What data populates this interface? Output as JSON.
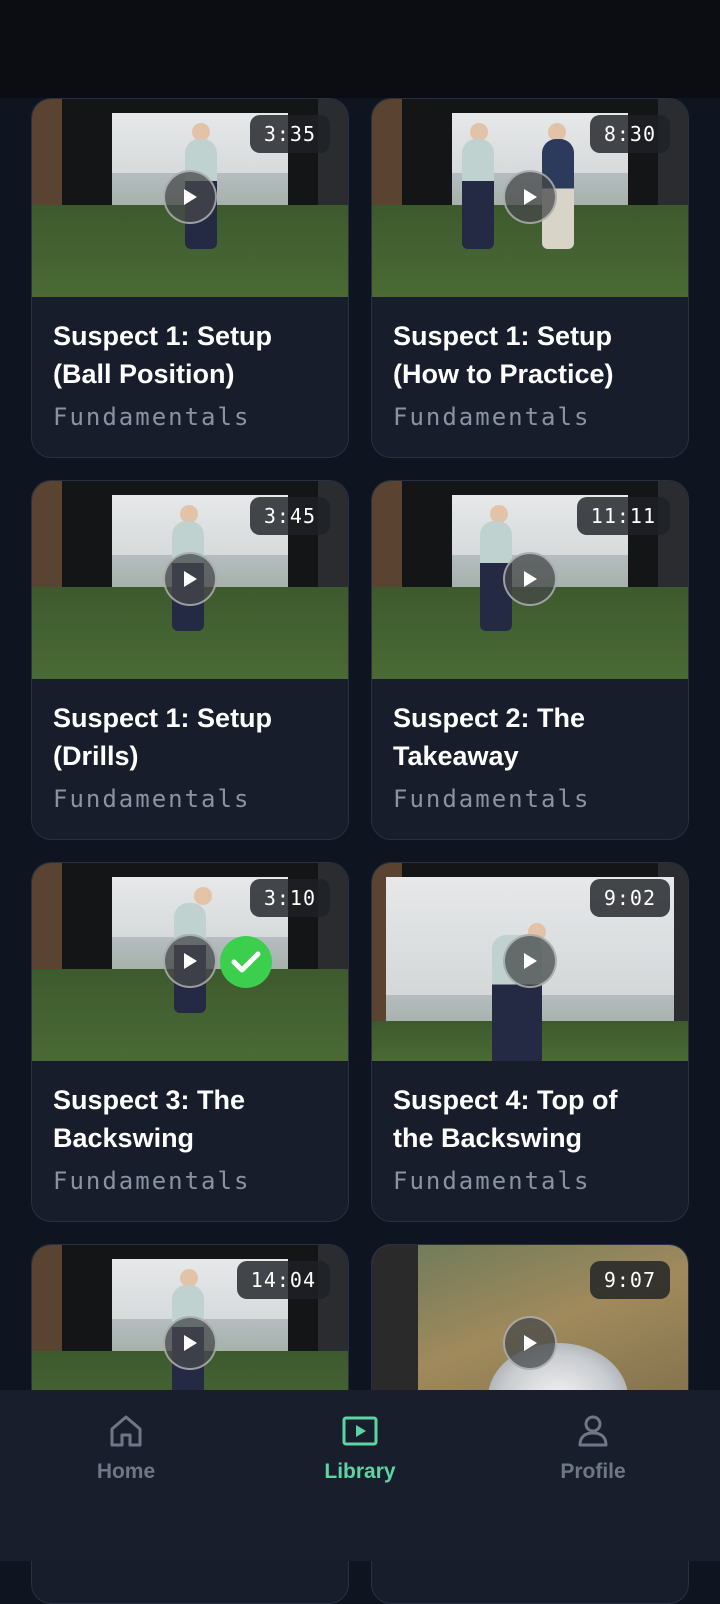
{
  "videos": [
    {
      "title_line1": "Suspect 1: Setup",
      "title_line2": "(Ball Position)",
      "category": "Fundamentals",
      "duration": "3:35",
      "completed": false
    },
    {
      "title_line1": "Suspect 1: Setup",
      "title_line2": "(How to Practice)",
      "category": "Fundamentals",
      "duration": "8:30",
      "completed": false
    },
    {
      "title_line1": "Suspect 1: Setup",
      "title_line2": "(Drills)",
      "category": "Fundamentals",
      "duration": "3:45",
      "completed": false
    },
    {
      "title_line1": "Suspect 2: The",
      "title_line2": "Takeaway",
      "category": "Fundamentals",
      "duration": "11:11",
      "completed": false
    },
    {
      "title_line1": "Suspect 3: The",
      "title_line2": "Backswing",
      "category": "Fundamentals",
      "duration": "3:10",
      "completed": true
    },
    {
      "title_line1": "Suspect 4: Top of",
      "title_line2": "the Backswing",
      "category": "Fundamentals",
      "duration": "9:02",
      "completed": false
    },
    {
      "duration": "14:04"
    },
    {
      "duration": "9:07"
    }
  ],
  "nav": {
    "items": [
      {
        "label": "Home",
        "icon": "home-icon",
        "active": false
      },
      {
        "label": "Library",
        "icon": "library-play-icon",
        "active": true
      },
      {
        "label": "Profile",
        "icon": "profile-icon",
        "active": false
      }
    ]
  },
  "colors": {
    "accent": "#5fd4a3",
    "completed": "#3ccf4e",
    "background": "#0e1420",
    "card": "#171d2b"
  }
}
